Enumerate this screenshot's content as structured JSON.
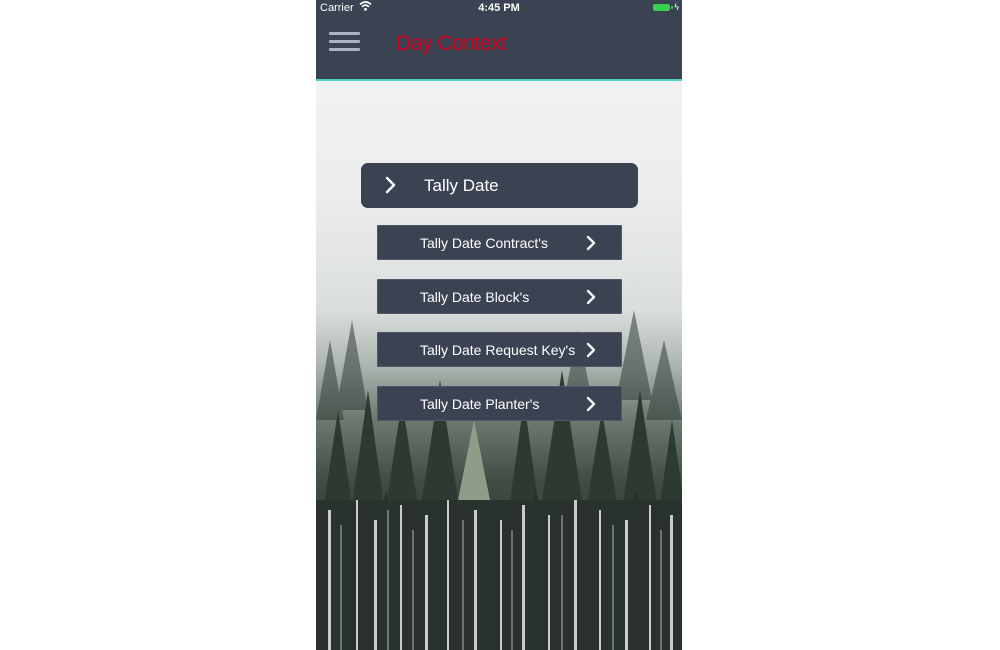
{
  "status_bar": {
    "carrier": "Carrier",
    "time": "4:45 PM"
  },
  "header": {
    "title": "Day Context"
  },
  "main_button": {
    "label": "Tally Date"
  },
  "sub_buttons": [
    {
      "label": "Tally Date Contract's"
    },
    {
      "label": "Tally Date Block's"
    },
    {
      "label": "Tally Date Request Key's"
    },
    {
      "label": "Tally Date Planter's"
    }
  ],
  "colors": {
    "header_bg": "#3b4252",
    "title": "#d1001c",
    "accent_line": "#4fd1c5",
    "menu_icon": "#a7b3c7",
    "battery": "#35d04c"
  },
  "icons": {
    "menu": "hamburger-icon",
    "chevron": "chevron-right-icon",
    "wifi": "wifi-icon",
    "battery": "battery-icon"
  }
}
